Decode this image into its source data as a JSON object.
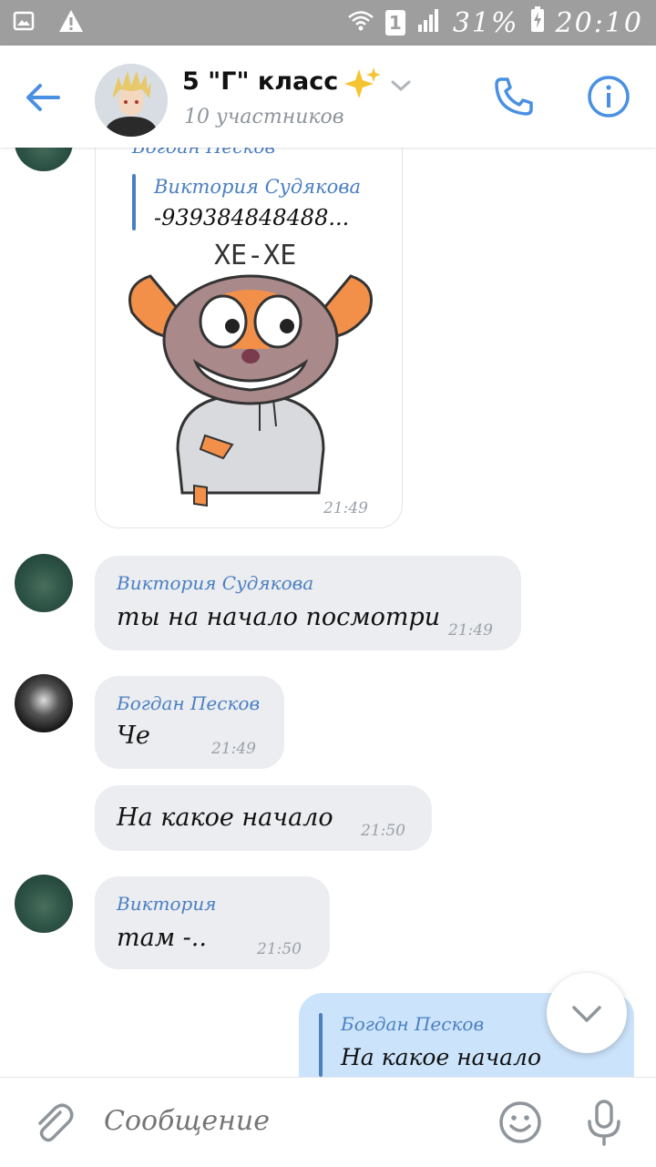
{
  "status_bar": {
    "icons": [
      "image-icon",
      "warning-icon",
      "wifi-icon",
      "sim-1-icon",
      "signal-icon",
      "battery-charging-icon"
    ],
    "sim_label": "1",
    "battery": "31%",
    "time": "20:10"
  },
  "header": {
    "title": "5 \"Г\" класс",
    "subtitle": "10 участников",
    "accent": "#4a90e2"
  },
  "messages": [
    {
      "sender": "Богдан Песков",
      "reply": {
        "author": "Виктория Судякова",
        "text": "-939384848488..."
      },
      "sticker_caption": "ХЕ-ХЕ",
      "time": "21:49"
    },
    {
      "sender": "Виктория Судякова",
      "text": "ты на начало посмотри",
      "time": "21:49"
    },
    {
      "sender": "Богдан Песков",
      "text": "Че",
      "time": "21:49"
    },
    {
      "sender": "",
      "text": "На какое начало",
      "time": "21:50"
    },
    {
      "sender": "Виктория",
      "text": "там -..",
      "time": "21:50"
    },
    {
      "sender": "",
      "reply": {
        "author": "Богдан Песков",
        "text": "На какое начало"
      }
    }
  ],
  "composer": {
    "placeholder": "Сообщение"
  },
  "colors": {
    "accent": "#4a90e2",
    "sender": "#4a7fc2",
    "bubble_in": "#ebedf0",
    "bubble_out": "#cce4fb",
    "status_bar": "#9e9e9e"
  }
}
